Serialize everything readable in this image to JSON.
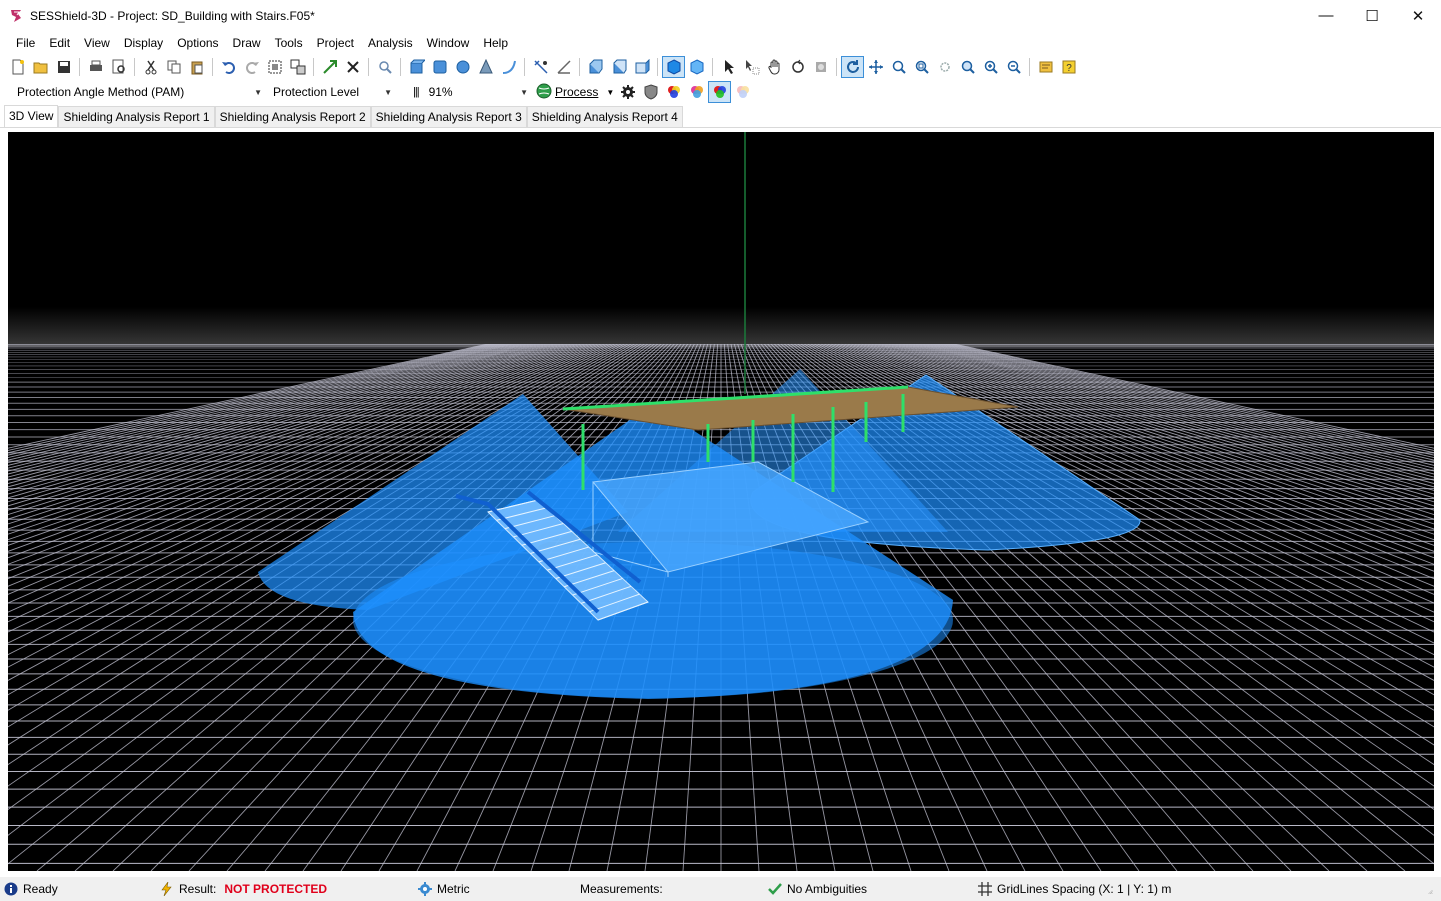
{
  "window": {
    "title": "SESShield-3D - Project: SD_Building with Stairs.F05*",
    "controls": {
      "minimize": "—",
      "maximize": "☐",
      "close": "✕"
    }
  },
  "menu": [
    "File",
    "Edit",
    "View",
    "Display",
    "Options",
    "Draw",
    "Tools",
    "Project",
    "Analysis",
    "Window",
    "Help"
  ],
  "toolbar2": {
    "method": "Protection Angle Method (PAM)",
    "level": "Protection Level",
    "zoom": "91%",
    "process_label": "Process"
  },
  "tabs": [
    {
      "label": "3D View",
      "active": true
    },
    {
      "label": "Shielding Analysis Report 1",
      "active": false
    },
    {
      "label": "Shielding Analysis Report 2",
      "active": false
    },
    {
      "label": "Shielding Analysis Report 3",
      "active": false
    },
    {
      "label": "Shielding Analysis Report 4",
      "active": false
    }
  ],
  "status": {
    "ready": "Ready",
    "result_label": "Result:",
    "result_value": "NOT PROTECTED",
    "units": "Metric",
    "measurements": "Measurements:",
    "ambiguities": "No Ambiguities",
    "grid": "GridLines Spacing (X: 1 | Y: 1) m"
  },
  "colors": {
    "viewport_bg": "#000000",
    "grid_line": "#c8c8d8",
    "zone_fill": "#1e90ff",
    "result_error": "#e0001b",
    "active_tab_border": "#3c8fd8"
  },
  "icons": {
    "app": "sesshield-logo-icon",
    "ready": "info-icon",
    "result": "lightning-icon",
    "units": "gear-globe-icon",
    "ambiguities": "checkmark-icon",
    "grid": "grid-icon"
  }
}
